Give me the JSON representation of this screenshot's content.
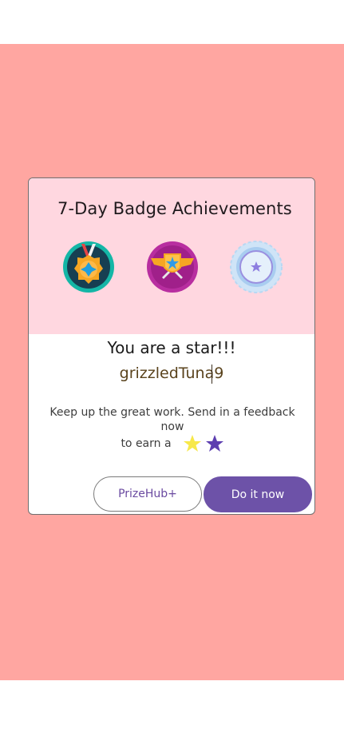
{
  "dialog": {
    "title": "7-Day Badge Achievements",
    "badges": [
      {
        "icon": "medal-badge-icon",
        "state": "earned"
      },
      {
        "icon": "winged-star-badge-icon",
        "state": "earned"
      },
      {
        "icon": "star-rosette-badge-icon",
        "state": "faded"
      }
    ],
    "heading": "You are a star!!!",
    "username": "grizzledTuna9",
    "message_line1": "Keep up the great work. Send in a feedback now",
    "message_line2": "to earn a",
    "reward_icons": [
      "yellow-star-icon",
      "purple-star-icon"
    ],
    "buttons": {
      "secondary": "PrizeHub+",
      "primary": "Do it now"
    }
  },
  "colors": {
    "backdrop": "#ffa6a1",
    "header_bg": "#ffd7e0",
    "primary": "#6d52a8",
    "username": "#5a431d"
  }
}
